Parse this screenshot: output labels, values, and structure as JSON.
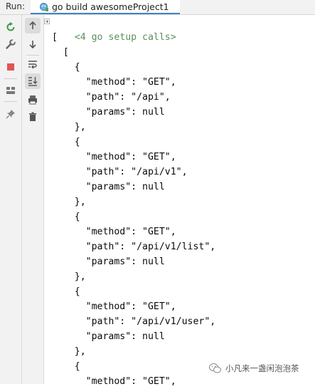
{
  "toolbar": {
    "run_label": "Run:",
    "tab_label": "go build awesomeProject1"
  },
  "left_toolbar": [
    {
      "name": "rerun-icon"
    },
    {
      "name": "wrench-icon"
    },
    {
      "name": "stop-icon"
    },
    {
      "name": "layout-icon"
    },
    {
      "name": "pin-icon"
    }
  ],
  "mid_toolbar": [
    {
      "name": "arrow-up-icon"
    },
    {
      "name": "arrow-down-icon"
    },
    {
      "name": "soft-wrap-icon"
    },
    {
      "name": "scroll-to-end-icon"
    },
    {
      "name": "print-icon"
    },
    {
      "name": "trash-icon"
    }
  ],
  "console": {
    "collapsed_header": "<4 go setup calls>",
    "lines": [
      "[",
      "  [",
      "    {",
      "      \"method\": \"GET\",",
      "      \"path\": \"/api\",",
      "      \"params\": null",
      "    },",
      "    {",
      "      \"method\": \"GET\",",
      "      \"path\": \"/api/v1\",",
      "      \"params\": null",
      "    },",
      "    {",
      "      \"method\": \"GET\",",
      "      \"path\": \"/api/v1/list\",",
      "      \"params\": null",
      "    },",
      "    {",
      "      \"method\": \"GET\",",
      "      \"path\": \"/api/v1/user\",",
      "      \"params\": null",
      "    },",
      "    {",
      "      \"method\": \"GET\","
    ]
  },
  "watermark": {
    "text": "小凡来一盏闲泡泡茶"
  }
}
